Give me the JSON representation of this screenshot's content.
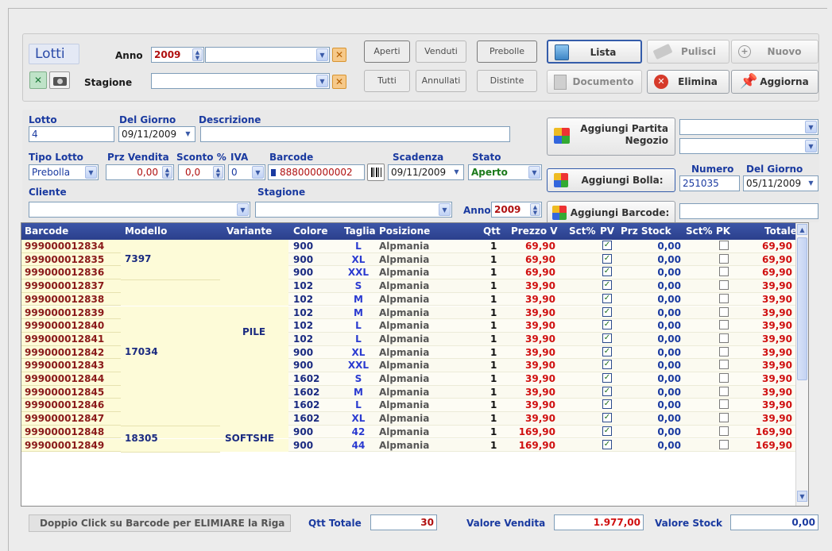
{
  "header": {
    "title": "Lotti",
    "anno_label": "Anno",
    "anno_value": "2009",
    "stagione_label": "Stagione",
    "filters": [
      "Aperti",
      "Venduti",
      "Prebolle",
      "Tutti",
      "Annullati",
      "Distinte"
    ],
    "actions": {
      "lista": "Lista",
      "pulisci": "Pulisci",
      "nuovo": "Nuovo",
      "documento": "Documento",
      "elimina": "Elimina",
      "aggiorna": "Aggiorna"
    }
  },
  "form": {
    "lotto_label": "Lotto",
    "lotto_value": "4",
    "del_giorno_label": "Del Giorno",
    "del_giorno_value": "09/11/2009",
    "descrizione_label": "Descrizione",
    "descrizione_value": "",
    "tipo_lotto_label": "Tipo Lotto",
    "tipo_lotto_value": "Prebolla",
    "prz_vendita_label": "Prz Vendita",
    "prz_vendita_value": "0,00",
    "sconto_label": "Sconto %",
    "sconto_value": "0,0",
    "iva_label": "IVA",
    "iva_value": "0",
    "barcode_label": "Barcode",
    "barcode_value": "888000000002",
    "scadenza_label": "Scadenza",
    "scadenza_value": "09/11/2009",
    "stato_label": "Stato",
    "stato_value": "Aperto",
    "cliente_label": "Cliente",
    "stagione_label": "Stagione",
    "anno_label": "Anno",
    "anno_value": "2009",
    "aggiungi_partita": "Aggiungi Partita",
    "aggiungi_partita_2": "Negozio",
    "aggiungi_bolla": "Aggiungi Bolla:",
    "aggiungi_barcode": "Aggiungi Barcode:",
    "numero_label": "Numero",
    "numero_value": "251035",
    "del_giorno2_label": "Del Giorno",
    "del_giorno2_value": "05/11/2009"
  },
  "table": {
    "columns": [
      "Barcode",
      "Modello",
      "Variante",
      "Colore",
      "Taglia",
      "Posizione",
      "Qtt",
      "Prezzo V",
      "Sct%",
      "PV",
      "Prz Stock",
      "Sct%",
      "PK",
      "Totale"
    ],
    "groups": [
      {
        "modello": "7397",
        "start": 0,
        "span": 3
      },
      {
        "modello": "17034",
        "start": 3,
        "span": 11
      },
      {
        "modello": "18305",
        "start": 14,
        "span": 2
      }
    ],
    "varianti": [
      {
        "variante": "PILE",
        "start": 0,
        "span": 14
      },
      {
        "variante": "SOFTSHE",
        "start": 14,
        "span": 2
      }
    ],
    "rows": [
      {
        "barcode": "999000012834",
        "colore": "900",
        "taglia": "L",
        "posizione": "Alpmania",
        "qtt": "1",
        "prezzo": "69,90",
        "pv": true,
        "stock": "0,00",
        "pk": false,
        "totale": "69,90"
      },
      {
        "barcode": "999000012835",
        "colore": "900",
        "taglia": "XL",
        "posizione": "Alpmania",
        "qtt": "1",
        "prezzo": "69,90",
        "pv": true,
        "stock": "0,00",
        "pk": false,
        "totale": "69,90"
      },
      {
        "barcode": "999000012836",
        "colore": "900",
        "taglia": "XXL",
        "posizione": "Alpmania",
        "qtt": "1",
        "prezzo": "69,90",
        "pv": true,
        "stock": "0,00",
        "pk": false,
        "totale": "69,90"
      },
      {
        "barcode": "999000012837",
        "colore": "102",
        "taglia": "S",
        "posizione": "Alpmania",
        "qtt": "1",
        "prezzo": "39,90",
        "pv": true,
        "stock": "0,00",
        "pk": false,
        "totale": "39,90"
      },
      {
        "barcode": "999000012838",
        "colore": "102",
        "taglia": "M",
        "posizione": "Alpmania",
        "qtt": "1",
        "prezzo": "39,90",
        "pv": true,
        "stock": "0,00",
        "pk": false,
        "totale": "39,90"
      },
      {
        "barcode": "999000012839",
        "colore": "102",
        "taglia": "M",
        "posizione": "Alpmania",
        "qtt": "1",
        "prezzo": "39,90",
        "pv": true,
        "stock": "0,00",
        "pk": false,
        "totale": "39,90"
      },
      {
        "barcode": "999000012840",
        "colore": "102",
        "taglia": "L",
        "posizione": "Alpmania",
        "qtt": "1",
        "prezzo": "39,90",
        "pv": true,
        "stock": "0,00",
        "pk": false,
        "totale": "39,90"
      },
      {
        "barcode": "999000012841",
        "colore": "102",
        "taglia": "L",
        "posizione": "Alpmania",
        "qtt": "1",
        "prezzo": "39,90",
        "pv": true,
        "stock": "0,00",
        "pk": false,
        "totale": "39,90"
      },
      {
        "barcode": "999000012842",
        "colore": "900",
        "taglia": "XL",
        "posizione": "Alpmania",
        "qtt": "1",
        "prezzo": "39,90",
        "pv": true,
        "stock": "0,00",
        "pk": false,
        "totale": "39,90"
      },
      {
        "barcode": "999000012843",
        "colore": "900",
        "taglia": "XXL",
        "posizione": "Alpmania",
        "qtt": "1",
        "prezzo": "39,90",
        "pv": true,
        "stock": "0,00",
        "pk": false,
        "totale": "39,90"
      },
      {
        "barcode": "999000012844",
        "colore": "1602",
        "taglia": "S",
        "posizione": "Alpmania",
        "qtt": "1",
        "prezzo": "39,90",
        "pv": true,
        "stock": "0,00",
        "pk": false,
        "totale": "39,90"
      },
      {
        "barcode": "999000012845",
        "colore": "1602",
        "taglia": "M",
        "posizione": "Alpmania",
        "qtt": "1",
        "prezzo": "39,90",
        "pv": true,
        "stock": "0,00",
        "pk": false,
        "totale": "39,90"
      },
      {
        "barcode": "999000012846",
        "colore": "1602",
        "taglia": "L",
        "posizione": "Alpmania",
        "qtt": "1",
        "prezzo": "39,90",
        "pv": true,
        "stock": "0,00",
        "pk": false,
        "totale": "39,90"
      },
      {
        "barcode": "999000012847",
        "colore": "1602",
        "taglia": "XL",
        "posizione": "Alpmania",
        "qtt": "1",
        "prezzo": "39,90",
        "pv": true,
        "stock": "0,00",
        "pk": false,
        "totale": "39,90"
      },
      {
        "barcode": "999000012848",
        "colore": "900",
        "taglia": "42",
        "posizione": "Alpmania",
        "qtt": "1",
        "prezzo": "169,90",
        "pv": true,
        "stock": "0,00",
        "pk": false,
        "totale": "169,90"
      },
      {
        "barcode": "999000012849",
        "colore": "900",
        "taglia": "44",
        "posizione": "Alpmania",
        "qtt": "1",
        "prezzo": "169,90",
        "pv": true,
        "stock": "0,00",
        "pk": false,
        "totale": "169,90"
      }
    ]
  },
  "footer": {
    "hint": "Doppio Click su Barcode per ELIMIARE la Riga",
    "qtt_totale_label": "Qtt Totale",
    "qtt_totale_value": "30",
    "valore_vendita_label": "Valore Vendita",
    "valore_vendita_value": "1.977,00",
    "valore_stock_label": "Valore Stock",
    "valore_stock_value": "0,00"
  },
  "colors": {
    "header_blue": "#2b3f8c",
    "barcode_red": "#8a1a1a",
    "price_red": "#d01010",
    "row_yellow": "#fdfbd8",
    "label_blue": "#1a3aa0"
  }
}
